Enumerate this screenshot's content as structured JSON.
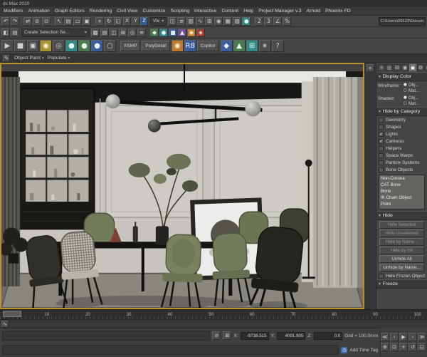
{
  "window": {
    "title": "ds Max 2020"
  },
  "menu": {
    "items": [
      "Modifiers",
      "Animation",
      "Graph Editors",
      "Rendering",
      "Civil View",
      "Customize",
      "Scripting",
      "Interactive",
      "Content",
      "Help",
      "Project Manager v.3",
      "Arnold",
      "Phoenix FD"
    ]
  },
  "ui": {
    "dropdown_arrow": "▾",
    "pencil_glyph": "✎",
    "layout_tab_glyph": "+"
  },
  "toolbar1": {
    "icons": [
      {
        "name": "undo",
        "glyph": "↶"
      },
      {
        "name": "redo",
        "glyph": "↷"
      },
      {
        "name": "select-and-link",
        "glyph": "⇄"
      },
      {
        "name": "unlink-selection",
        "glyph": "⊘"
      },
      {
        "name": "bind-to-space-warp",
        "glyph": "⊙"
      },
      {
        "name": "select-object",
        "glyph": "↖"
      },
      {
        "name": "select-by-name",
        "glyph": "▤"
      },
      {
        "name": "rectangular-selection",
        "glyph": "▭"
      },
      {
        "name": "window-crossing",
        "glyph": "▣"
      },
      {
        "name": "select-and-move",
        "glyph": "+"
      },
      {
        "name": "select-and-rotate",
        "glyph": "↻"
      },
      {
        "name": "select-and-scale",
        "glyph": "◱"
      }
    ],
    "axis_buttons": [
      "X",
      "Y",
      "Z"
    ],
    "ref_coord_value": "Vie",
    "icons2": [
      {
        "name": "mirror",
        "glyph": "◫"
      },
      {
        "name": "align",
        "glyph": "≡"
      },
      {
        "name": "scene-explorer",
        "glyph": "▥"
      },
      {
        "name": "curve-editor",
        "glyph": "∿"
      },
      {
        "name": "schematic-view",
        "glyph": "⊞"
      },
      {
        "name": "material-editor",
        "glyph": "◉"
      },
      {
        "name": "render-setup",
        "glyph": "▦"
      },
      {
        "name": "rendered-frame-window",
        "glyph": "▨"
      },
      {
        "name": "render-production",
        "glyph": "●"
      }
    ],
    "snap_icons": [
      {
        "name": "snap-toggle-2d",
        "glyph": "2"
      },
      {
        "name": "snap-toggle-3d",
        "glyph": "3"
      },
      {
        "name": "angle-snap",
        "glyph": "∠"
      },
      {
        "name": "percent-snap",
        "glyph": "%"
      }
    ],
    "path_field": "C:\\Users\\20122\\Docum..."
  },
  "toolbar2": {
    "icons_left": [
      {
        "name": "named-selection-sets",
        "glyph": "◧"
      },
      {
        "name": "edit-named-selections",
        "glyph": "▤"
      }
    ],
    "selection_set_value": "Create Selection Se...",
    "icons_right": [
      {
        "name": "track-view",
        "glyph": "▩"
      },
      {
        "name": "layer-manager",
        "glyph": "▤"
      },
      {
        "name": "graphite-ribbon",
        "glyph": "◫"
      },
      {
        "name": "array-tool",
        "glyph": "⊞"
      },
      {
        "name": "snapshot",
        "glyph": "◎"
      },
      {
        "name": "measure",
        "glyph": "≡"
      },
      {
        "name": "plugin-green",
        "glyph": "◆"
      },
      {
        "name": "plugin-teal",
        "glyph": "●"
      },
      {
        "name": "plugin-blue",
        "glyph": "■"
      },
      {
        "name": "plugin-purple",
        "glyph": "▲"
      },
      {
        "name": "plugin-orange",
        "glyph": "◉"
      },
      {
        "name": "plugin-red",
        "glyph": "◈"
      }
    ]
  },
  "toolbar3": {
    "icons_left": [
      {
        "name": "play-script",
        "glyph": "▶"
      },
      {
        "name": "stop-script",
        "glyph": "■"
      },
      {
        "name": "scene-states",
        "glyph": "▣"
      },
      {
        "name": "light-lister",
        "glyph": "◉"
      },
      {
        "name": "camera-tool",
        "glyph": "◎"
      },
      {
        "name": "teapot-render",
        "glyph": "●"
      },
      {
        "name": "teapot-iterative",
        "glyph": "●"
      },
      {
        "name": "sphere-shaded",
        "glyph": "●"
      },
      {
        "name": "sphere-wire",
        "glyph": "○"
      }
    ],
    "buttons": [
      "XSMP",
      "PolyDetail",
      "Copitor"
    ],
    "r8_label": "R8",
    "icons_right": [
      {
        "name": "vray-icon",
        "glyph": "◆"
      },
      {
        "name": "corona-icon",
        "glyph": "◉"
      },
      {
        "name": "forest-icon",
        "glyph": "▲"
      },
      {
        "name": "railclone-icon",
        "glyph": "⊞"
      },
      {
        "name": "multiscatter-icon",
        "glyph": "∗"
      },
      {
        "name": "help",
        "glyph": "?"
      }
    ]
  },
  "ribbon": {
    "tabs": [
      "Object Paint",
      "Populate"
    ]
  },
  "command_panel": {
    "tabs": [
      {
        "name": "create",
        "glyph": "+"
      },
      {
        "name": "modify",
        "glyph": "◎"
      },
      {
        "name": "hierarchy",
        "glyph": "⊟"
      },
      {
        "name": "motion",
        "glyph": "◉"
      },
      {
        "name": "display",
        "glyph": "▣"
      },
      {
        "name": "utilities",
        "glyph": "⚙"
      }
    ],
    "extra_tab_glyph": "◉",
    "display_color": {
      "title": "Display Color",
      "rows": [
        {
          "label": "Wireframe:",
          "options": [
            {
              "mark": "●",
              "label": "Obj..."
            },
            {
              "mark": "○",
              "label": "Mat..."
            }
          ]
        },
        {
          "label": "Shaded:",
          "options": [
            {
              "mark": "●",
              "label": "Obj..."
            },
            {
              "mark": "○",
              "label": "Mat..."
            }
          ]
        }
      ]
    },
    "hide_by_category": {
      "title": "Hide by Category",
      "items": [
        {
          "label": "Geometry",
          "mark": ""
        },
        {
          "label": "Shapes",
          "mark": ""
        },
        {
          "label": "Lights",
          "mark": "✓"
        },
        {
          "label": "Cameras",
          "mark": "✓"
        },
        {
          "label": "Helpers",
          "mark": ""
        },
        {
          "label": "Space Warps",
          "mark": ""
        },
        {
          "label": "Particle Systems",
          "mark": ""
        },
        {
          "label": "Bone Objects",
          "mark": ""
        }
      ],
      "list_items": [
        "Non-Corona",
        "CAT Bone",
        "Bone",
        "IK Chain Object",
        "Point"
      ]
    },
    "hide": {
      "title": "Hide",
      "buttons_disabled": [
        "Hide Selected",
        "Hide Unselected",
        "Hide by Name...",
        "Hide by Hit"
      ],
      "buttons": [
        "Unhide All",
        "Unhide by Name..."
      ],
      "frozen_checkbox": {
        "label": "Hide Frozen Objects",
        "mark": ""
      }
    },
    "freeze": {
      "title": "Freeze"
    }
  },
  "timeline": {
    "labels": [
      "0",
      "10",
      "20",
      "30",
      "40",
      "50",
      "60",
      "70",
      "80",
      "90",
      "100"
    ]
  },
  "trackbar": {
    "icon_glyph": "∿"
  },
  "status": {
    "x_label": "X:",
    "x_value": "-9738.515",
    "y_label": "Y:",
    "y_value": "4091.905",
    "z_label": "Z:",
    "z_value": "0.0",
    "grid": "Grid = 100.0mm",
    "add_time_tag": "Add Time Tag",
    "clock_glyph": "◷",
    "isolate_glyph": "⊘",
    "lock_glyph": "⊠"
  },
  "transport": {
    "icons": [
      {
        "name": "go-to-start",
        "glyph": "≪"
      },
      {
        "name": "previous-frame",
        "glyph": "‹"
      },
      {
        "name": "play-animation",
        "glyph": "▶"
      },
      {
        "name": "next-frame",
        "glyph": "›"
      },
      {
        "name": "go-to-end",
        "glyph": "≫"
      }
    ],
    "nav_icons": [
      {
        "name": "zoom",
        "glyph": "⊕"
      },
      {
        "name": "zoom-extents",
        "glyph": "⊡"
      },
      {
        "name": "pan",
        "glyph": "+"
      },
      {
        "name": "orbit",
        "glyph": "↺"
      },
      {
        "name": "maximize-viewport",
        "glyph": "◱"
      }
    ]
  },
  "colors": {
    "viewport_border": "#b8942f",
    "chair_green": "#79825f",
    "panel_bg": "#454545",
    "accent_blue": "#3b6fb5"
  }
}
